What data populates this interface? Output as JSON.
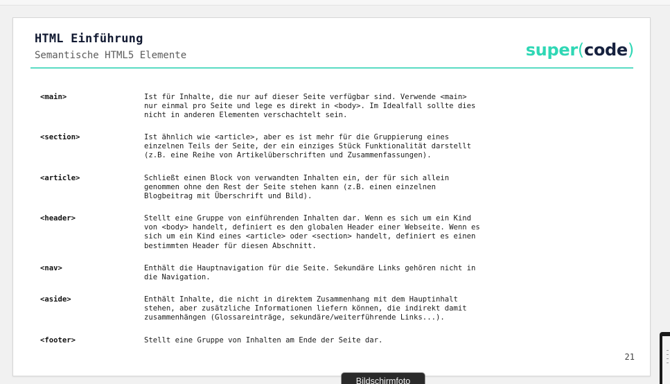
{
  "slide": {
    "title": "HTML Einführung",
    "subtitle": "Semantische HTML5 Elemente",
    "logo": {
      "word_super": "super",
      "paren_open": "(",
      "word_code": "code",
      "paren_close": ")"
    },
    "page_number": "21",
    "items": [
      {
        "tag": "<main>",
        "description": "Ist für Inhalte, die nur auf dieser Seite verfügbar sind. Verwende <main>\nnur einmal pro Seite und lege es direkt in <body>. Im Idealfall sollte dies\nnicht in anderen Elementen verschachtelt sein."
      },
      {
        "tag": "<section>",
        "description": "Ist ähnlich wie <article>, aber es ist mehr für die Gruppierung eines\neinzelnen Teils der Seite, der ein einziges Stück Funktionalität darstellt\n(z.B. eine Reihe von Artikelüberschriften und Zusammenfassungen)."
      },
      {
        "tag": "<article>",
        "description": "Schließt einen Block von verwandten Inhalten ein, der für sich allein\ngenommen ohne den Rest der Seite stehen kann (z.B. einen einzelnen\nBlogbeitrag mit Überschrift und Bild)."
      },
      {
        "tag": "<header>",
        "description": "Stellt eine Gruppe von einführenden Inhalten dar. Wenn es sich um ein Kind\nvon <body> handelt, definiert es den globalen Header einer Webseite. Wenn es\nsich um ein Kind eines <article> oder <section> handelt, definiert es einen\nbestimmten Header für diesen Abschnitt."
      },
      {
        "tag": "<nav>",
        "description": "Enthält die Hauptnavigation für die Seite. Sekundäre Links gehören nicht in\ndie Navigation."
      },
      {
        "tag": "<aside>",
        "description": "Enthält Inhalte, die nicht in direktem Zusammenhang mit dem Hauptinhalt\nstehen, aber zusätzliche Informationen liefern können, die indirekt damit\nzusammenhängen (Glossareinträge, sekundäre/weiterführende Links...)."
      },
      {
        "tag": "<footer>",
        "description": "Stellt eine Gruppe von Inhalten am Ende der Seite dar."
      }
    ]
  },
  "tooltip": {
    "label": "Bildschirmfoto"
  },
  "colors": {
    "accent": "#2fd7b5",
    "rule": "#59dcc3",
    "logo_dark": "#16213e"
  }
}
